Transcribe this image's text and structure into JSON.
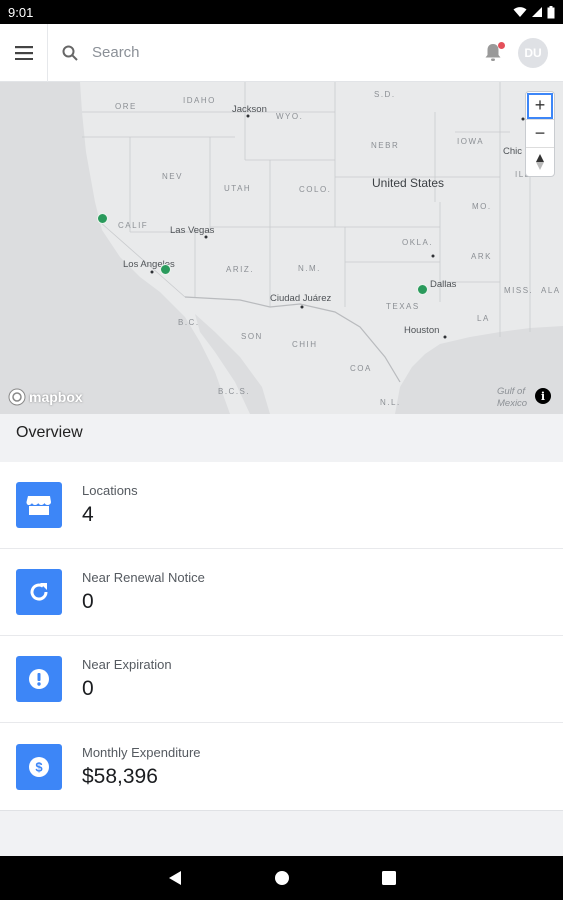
{
  "status_bar": {
    "time": "9:01"
  },
  "app_bar": {
    "search_placeholder": "Search",
    "avatar_initials": "DU"
  },
  "map": {
    "country_label": "United States",
    "region_labels": [
      "ORE",
      "IDAHO",
      "WYO.",
      "S.D.",
      "NEBR",
      "IOWA",
      "NEV",
      "UTAH",
      "COLO.",
      "CALIF",
      "ARIZ.",
      "N.M.",
      "OKLA.",
      "ARK",
      "TEXAS",
      "MISS.",
      "LA",
      "MO.",
      "ILL",
      "ALA",
      "B.C.",
      "SON",
      "CHIH",
      "COA",
      "N.L.",
      "B.C.S."
    ],
    "cities": [
      "Jackson",
      "Las Vegas",
      "Los Angeles",
      "Ciudad Juárez",
      "Dallas",
      "Houston",
      "Chic"
    ],
    "gulf_label": "Gulf of Mexico",
    "attribution": "mapbox",
    "zoom_in": "+",
    "zoom_out": "−",
    "pin_color": "#2a9a5c"
  },
  "overview": {
    "title": "Overview",
    "cards": [
      {
        "label": "Locations",
        "value": "4",
        "icon": "store-icon"
      },
      {
        "label": "Near Renewal Notice",
        "value": "0",
        "icon": "refresh-icon"
      },
      {
        "label": "Near Expiration",
        "value": "0",
        "icon": "alert-icon"
      },
      {
        "label": "Monthly Expenditure",
        "value": "$58,396",
        "icon": "dollar-icon"
      }
    ]
  },
  "colors": {
    "accent": "#3d86f7",
    "map_bg": "#e9eaeb",
    "water": "#dcdddf"
  }
}
